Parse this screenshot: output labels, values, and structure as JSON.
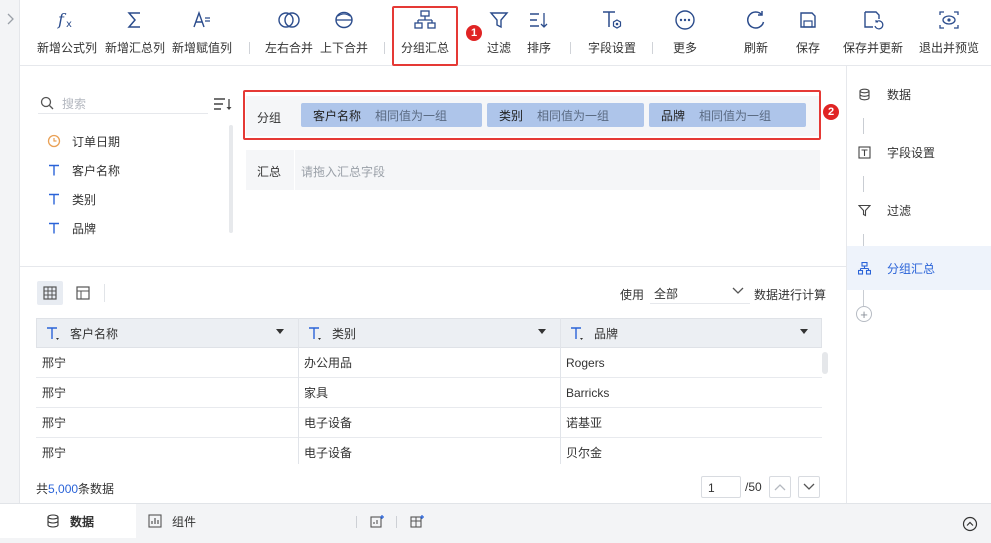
{
  "toolbar": {
    "items": [
      {
        "label": "新增公式列",
        "icon": "formula-fx-icon"
      },
      {
        "label": "新增汇总列",
        "icon": "sigma-icon"
      },
      {
        "label": "新增赋值列",
        "icon": "assign-value-icon"
      },
      {
        "label": "左右合并",
        "icon": "merge-horizontal-icon"
      },
      {
        "label": "上下合并",
        "icon": "merge-vertical-icon"
      },
      {
        "label": "分组汇总",
        "icon": "group-summary-icon"
      },
      {
        "label": "过滤",
        "icon": "filter-icon"
      },
      {
        "label": "排序",
        "icon": "sort-icon"
      },
      {
        "label": "字段设置",
        "icon": "field-settings-icon"
      },
      {
        "label": "更多",
        "icon": "more-icon"
      },
      {
        "label": "刷新",
        "icon": "refresh-icon"
      },
      {
        "label": "保存",
        "icon": "save-icon"
      },
      {
        "label": "保存并更新",
        "icon": "save-update-icon"
      },
      {
        "label": "退出并预览",
        "icon": "exit-preview-icon"
      }
    ],
    "badge1": "1"
  },
  "field_panel": {
    "search_placeholder": "搜索",
    "fields": [
      {
        "label": "订单日期",
        "type": "date"
      },
      {
        "label": "客户名称",
        "type": "text"
      },
      {
        "label": "类别",
        "type": "text"
      },
      {
        "label": "品牌",
        "type": "text"
      }
    ]
  },
  "group_config": {
    "group_label": "分组",
    "chips": [
      {
        "name": "客户名称",
        "desc": "相同值为一组"
      },
      {
        "name": "类别",
        "desc": "相同值为一组"
      },
      {
        "name": "品牌",
        "desc": "相同值为一组"
      }
    ],
    "badge2": "2",
    "summary_label": "汇总",
    "summary_placeholder": "请拖入汇总字段"
  },
  "table_toolbar": {
    "use_label": "使用",
    "use_value": "全部",
    "calc_label": "数据进行计算"
  },
  "table": {
    "columns": [
      "客户名称",
      "类别",
      "品牌"
    ],
    "rows": [
      [
        "邢宁",
        "办公用品",
        "Rogers"
      ],
      [
        "邢宁",
        "家具",
        "Barricks"
      ],
      [
        "邢宁",
        "电子设备",
        "诺基亚"
      ],
      [
        "邢宁",
        "电子设备",
        "贝尔金"
      ]
    ]
  },
  "footer": {
    "total_prefix": "共",
    "total_count": "5,000",
    "total_suffix": "条数据",
    "page_current": "1",
    "page_total": "/50"
  },
  "right_panel": {
    "steps": [
      {
        "label": "数据",
        "icon": "database-icon"
      },
      {
        "label": "字段设置",
        "icon": "field-settings-icon"
      },
      {
        "label": "过滤",
        "icon": "filter-icon"
      },
      {
        "label": "分组汇总",
        "icon": "group-summary-icon"
      }
    ],
    "add": "+"
  },
  "bottom_tabs": {
    "data_tab": "数据",
    "component_tab": "组件"
  },
  "colors": {
    "accent": "#2a63d8",
    "highlight": "#e53935",
    "chip": "#aec5ea"
  }
}
